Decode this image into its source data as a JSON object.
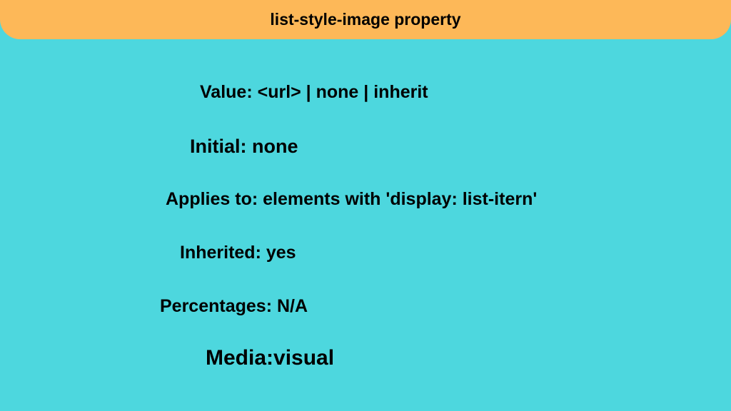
{
  "header": {
    "title": "list-style-image property"
  },
  "props": {
    "value": "Value:  <url> | none | inherit",
    "initial": "Initial: none",
    "applies_to": "Applies to: elements with 'display: list-itern'",
    "inherited": "Inherited: yes",
    "percentages": "Percentages: N/A",
    "media": "Media:visual"
  }
}
